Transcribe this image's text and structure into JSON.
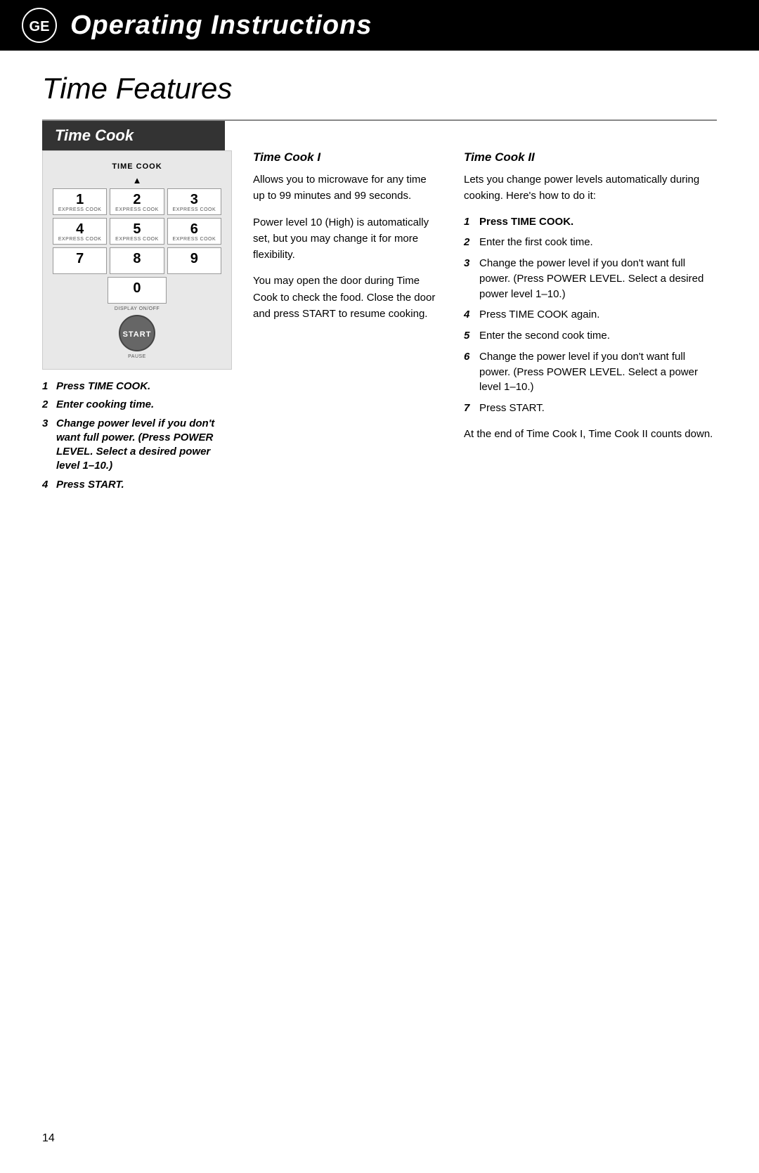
{
  "header": {
    "title": "Operating Instructions",
    "icon_alt": "GE logo"
  },
  "page": {
    "main_title": "Time Features",
    "page_number": "14"
  },
  "section": {
    "label": "Time Cook",
    "keypad": {
      "time_cook_label": "TIME COOK",
      "keys": [
        {
          "number": "1",
          "sublabel": "EXPRESS COOK"
        },
        {
          "number": "2",
          "sublabel": "EXPRESS COOK"
        },
        {
          "number": "3",
          "sublabel": "EXPRESS COOK"
        },
        {
          "number": "4",
          "sublabel": "EXPRESS COOK"
        },
        {
          "number": "5",
          "sublabel": "EXPRESS COOK"
        },
        {
          "number": "6",
          "sublabel": "EXPRESS COOK"
        },
        {
          "number": "7",
          "sublabel": ""
        },
        {
          "number": "8",
          "sublabel": ""
        },
        {
          "number": "9",
          "sublabel": ""
        }
      ],
      "zero": {
        "number": "0",
        "sublabel": ""
      },
      "display_label": "DISPLAY ON/OFF",
      "start_label": "START",
      "pause_label": "PAUSE"
    },
    "left_steps": [
      {
        "num": "1",
        "text": "Press TIME COOK.",
        "bold": true
      },
      {
        "num": "2",
        "text": "Enter cooking time.",
        "bold": true
      },
      {
        "num": "3",
        "text": "Change power level if you don't want full power. (Press POWER LEVEL. Select a desired power level 1–10.)",
        "bold": true
      },
      {
        "num": "4",
        "text": "Press START.",
        "bold": true
      }
    ],
    "time_cook_1": {
      "subtitle": "Time Cook I",
      "paragraphs": [
        "Allows you to microwave for any time up to 99 minutes and 99 seconds.",
        "Power level 10 (High) is automatically set, but you may change it for more flexibility.",
        "You may open the door during Time Cook to check the food. Close the door and press START to resume cooking."
      ]
    },
    "time_cook_2": {
      "subtitle": "Time Cook II",
      "intro": "Lets you change power levels automatically during cooking. Here's how to do it:",
      "steps": [
        {
          "num": "1",
          "text": "Press TIME COOK.",
          "bold": true
        },
        {
          "num": "2",
          "text": "Enter the first cook time.",
          "bold": false
        },
        {
          "num": "3",
          "text": "Change the power level if you don't want full power. (Press POWER LEVEL. Select a desired power level 1–10.)",
          "bold": false
        },
        {
          "num": "4",
          "text": "Press TIME COOK again.",
          "bold": false
        },
        {
          "num": "5",
          "text": "Enter the second cook time.",
          "bold": false
        },
        {
          "num": "6",
          "text": "Change the power level if you don't want full power. (Press POWER LEVEL. Select a power level 1–10.)",
          "bold": false
        },
        {
          "num": "7",
          "text": "Press START.",
          "bold": false
        }
      ],
      "closing": "At the end of Time Cook I, Time Cook II counts down."
    }
  }
}
